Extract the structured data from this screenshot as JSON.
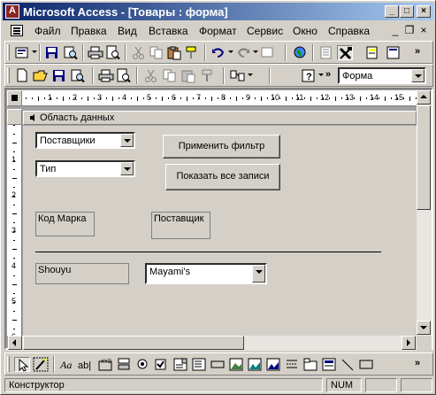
{
  "window": {
    "title": "Microsoft Access - [Товары : форма]",
    "app_icon_letter": "A"
  },
  "menu": {
    "items": [
      "Файл",
      "Правка",
      "Вид",
      "Вставка",
      "Формат",
      "Сервис",
      "Окно",
      "Справка"
    ],
    "mdi_minimize": "_",
    "mdi_restore": "❐",
    "mdi_close": "×"
  },
  "toolbar2": {
    "object_combo_value": "Форма"
  },
  "rulers": {
    "horizontal": [
      "1",
      "2",
      "3",
      "4",
      "5",
      "6",
      "7",
      "8",
      "9",
      "10",
      "11",
      "12",
      "13",
      "14",
      "15"
    ],
    "vertical": [
      "1",
      "2",
      "3",
      "4",
      "5",
      "6"
    ]
  },
  "form": {
    "section_title": "Область данных",
    "combo_suppliers": "Поставщики",
    "combo_type": "Тип",
    "apply_filter_button": "Применить фильтр",
    "show_all_button": "Показать все записи",
    "label_brand_code": "Код Марка",
    "label_supplier": "Поставщик",
    "field_brand_code": "Shouyu",
    "combo_supplier_value": "Mayami's"
  },
  "statusbar": {
    "mode": "Конструктор",
    "num": "NUM"
  },
  "colors": {
    "titlebar_start": "#0a246a",
    "titlebar_end": "#a6caf0",
    "face": "#d4d0c8"
  }
}
